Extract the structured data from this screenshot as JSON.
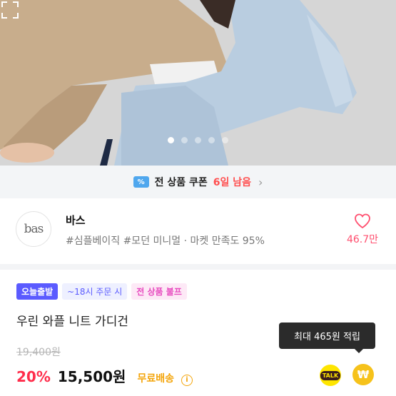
{
  "hero": {
    "image_alt": "",
    "page_count": 5,
    "active_page": 1
  },
  "coupon": {
    "icon_glyph": "%",
    "text": "전 상품 쿠폰",
    "days_left": "6일 남음",
    "chevron": "›"
  },
  "shop": {
    "logo_text": "bas",
    "name": "바스",
    "tags": "#심플베이직 #모던 미니멀 · 마켓 만족도 95%",
    "like_count": "46.7만"
  },
  "badges": {
    "today": "오늘출발",
    "cutoff": "~18시 주문 시",
    "free_shipping": "전 상품 불프"
  },
  "product": {
    "title": "우린 와플 니트 가디건",
    "original_price": "19,400원",
    "discount": "20%",
    "price": "15,500원",
    "shipping": "무료배송",
    "info_glyph": "i"
  },
  "reward": {
    "tooltip": "최대 465원 적립",
    "talk_label": "TALK",
    "point_glyph": "₩"
  },
  "colors": {
    "accent_red": "#ff2d4b",
    "accent_blue": "#5b5bff",
    "heart_pink": "#ff4f6f",
    "shipping_orange": "#f4a50b"
  }
}
